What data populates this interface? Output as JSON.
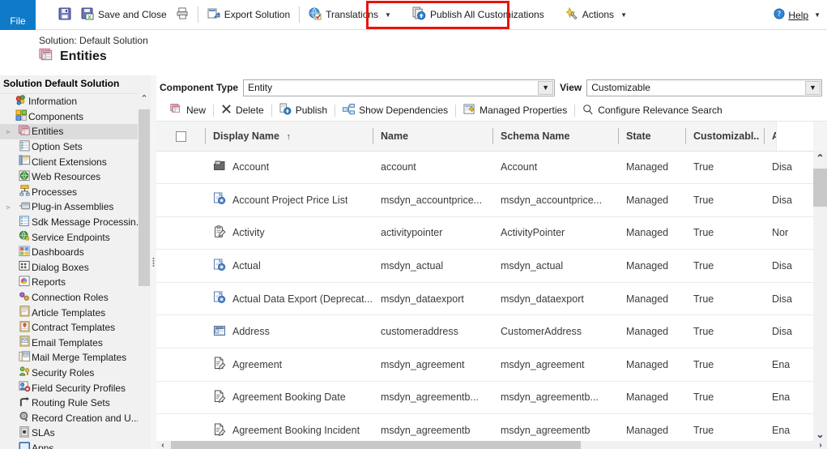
{
  "ribbon": {
    "file_label": "File",
    "buttons": [
      {
        "label": "",
        "icon": "save-icon",
        "name": "save-button"
      },
      {
        "label": "Save and Close",
        "icon": "save-and-close-icon",
        "name": "save-and-close-button"
      },
      {
        "label": "",
        "icon": "print-icon",
        "name": "print-button"
      },
      {
        "label": "Export Solution",
        "icon": "export-solution-icon",
        "name": "export-solution-button"
      },
      {
        "label": "Translations",
        "icon": "translations-icon",
        "name": "translations-button",
        "caret": true
      },
      {
        "label": "Publish All Customizations",
        "icon": "publish-all-icon",
        "name": "publish-all-customizations-button"
      },
      {
        "label": "Actions",
        "icon": "actions-icon",
        "name": "actions-button",
        "caret": true
      }
    ],
    "help_label": "Help",
    "highlight_color": "#e8140c"
  },
  "titlebar": {
    "solution_line": "Solution: Default Solution",
    "page_title": "Entities"
  },
  "sidebar": {
    "header": "Solution Default Solution",
    "items": [
      {
        "label": "Information",
        "icon": "information-icon",
        "indent": 0,
        "expander": "",
        "selected": false
      },
      {
        "label": "Components",
        "icon": "components-icon",
        "indent": 0,
        "expander": "",
        "selected": false
      },
      {
        "label": "Entities",
        "icon": "entities-icon",
        "indent": 1,
        "expander": "▹",
        "selected": true
      },
      {
        "label": "Option Sets",
        "icon": "option-sets-icon",
        "indent": 1,
        "expander": "",
        "selected": false
      },
      {
        "label": "Client Extensions",
        "icon": "client-extensions-icon",
        "indent": 1,
        "expander": "",
        "selected": false
      },
      {
        "label": "Web Resources",
        "icon": "web-resources-icon",
        "indent": 1,
        "expander": "",
        "selected": false
      },
      {
        "label": "Processes",
        "icon": "processes-icon",
        "indent": 1,
        "expander": "",
        "selected": false
      },
      {
        "label": "Plug-in Assemblies",
        "icon": "plugin-assemblies-icon",
        "indent": 1,
        "expander": "▹",
        "selected": false
      },
      {
        "label": "Sdk Message Processin...",
        "icon": "sdk-message-icon",
        "indent": 1,
        "expander": "",
        "selected": false
      },
      {
        "label": "Service Endpoints",
        "icon": "service-endpoints-icon",
        "indent": 1,
        "expander": "",
        "selected": false
      },
      {
        "label": "Dashboards",
        "icon": "dashboards-icon",
        "indent": 1,
        "expander": "",
        "selected": false
      },
      {
        "label": "Dialog Boxes",
        "icon": "dialog-boxes-icon",
        "indent": 1,
        "expander": "",
        "selected": false
      },
      {
        "label": "Reports",
        "icon": "reports-icon",
        "indent": 1,
        "expander": "",
        "selected": false
      },
      {
        "label": "Connection Roles",
        "icon": "connection-roles-icon",
        "indent": 1,
        "expander": "",
        "selected": false
      },
      {
        "label": "Article Templates",
        "icon": "article-templates-icon",
        "indent": 1,
        "expander": "",
        "selected": false
      },
      {
        "label": "Contract Templates",
        "icon": "contract-templates-icon",
        "indent": 1,
        "expander": "",
        "selected": false
      },
      {
        "label": "Email Templates",
        "icon": "email-templates-icon",
        "indent": 1,
        "expander": "",
        "selected": false
      },
      {
        "label": "Mail Merge Templates",
        "icon": "mail-merge-templates-icon",
        "indent": 1,
        "expander": "",
        "selected": false
      },
      {
        "label": "Security Roles",
        "icon": "security-roles-icon",
        "indent": 1,
        "expander": "",
        "selected": false
      },
      {
        "label": "Field Security Profiles",
        "icon": "field-security-profiles-icon",
        "indent": 1,
        "expander": "",
        "selected": false
      },
      {
        "label": "Routing Rule Sets",
        "icon": "routing-rule-sets-icon",
        "indent": 1,
        "expander": "",
        "selected": false
      },
      {
        "label": "Record Creation and U...",
        "icon": "record-creation-icon",
        "indent": 1,
        "expander": "",
        "selected": false
      },
      {
        "label": "SLAs",
        "icon": "slas-icon",
        "indent": 1,
        "expander": "",
        "selected": false
      },
      {
        "label": "Apps",
        "icon": "apps-icon",
        "indent": 1,
        "expander": "",
        "selected": false
      }
    ]
  },
  "filters": {
    "component_type_label": "Component Type",
    "component_type_value": "Entity",
    "view_label": "View",
    "view_value": "Customizable"
  },
  "actionbar": {
    "buttons": [
      {
        "label": "New",
        "icon": "new-icon",
        "name": "new-button"
      },
      {
        "label": "Delete",
        "icon": "delete-icon",
        "name": "delete-button"
      },
      {
        "label": "Publish",
        "icon": "publish-icon",
        "name": "publish-button"
      },
      {
        "label": "Show Dependencies",
        "icon": "show-dependencies-icon",
        "name": "show-dependencies-button"
      },
      {
        "label": "Managed Properties",
        "icon": "managed-properties-icon",
        "name": "managed-properties-button"
      },
      {
        "label": "Configure Relevance Search",
        "icon": "search-icon",
        "name": "configure-relevance-search-button"
      }
    ]
  },
  "grid": {
    "columns": [
      {
        "label": "Display Name",
        "sort": "↑"
      },
      {
        "label": "Name",
        "sort": ""
      },
      {
        "label": "Schema Name",
        "sort": ""
      },
      {
        "label": "State",
        "sort": ""
      },
      {
        "label": "Customizabl..",
        "sort": ""
      },
      {
        "label": "A",
        "sort": ""
      }
    ],
    "rows": [
      {
        "icon": "account-entity-icon",
        "display_name": "Account",
        "name": "account",
        "schema_name": "Account",
        "state": "Managed",
        "customizable": "True",
        "audit": "Disa"
      },
      {
        "icon": "custom-entity-icon",
        "display_name": "Account Project Price List",
        "name": "msdyn_accountprice...",
        "schema_name": "msdyn_accountprice...",
        "state": "Managed",
        "customizable": "True",
        "audit": "Disa"
      },
      {
        "icon": "activity-entity-icon",
        "display_name": "Activity",
        "name": "activitypointer",
        "schema_name": "ActivityPointer",
        "state": "Managed",
        "customizable": "True",
        "audit": "Nor"
      },
      {
        "icon": "custom-entity-icon",
        "display_name": "Actual",
        "name": "msdyn_actual",
        "schema_name": "msdyn_actual",
        "state": "Managed",
        "customizable": "True",
        "audit": "Disa"
      },
      {
        "icon": "custom-entity-icon",
        "display_name": "Actual Data Export (Deprecat...",
        "name": "msdyn_dataexport",
        "schema_name": "msdyn_dataexport",
        "state": "Managed",
        "customizable": "True",
        "audit": "Disa"
      },
      {
        "icon": "address-entity-icon",
        "display_name": "Address",
        "name": "customeraddress",
        "schema_name": "CustomerAddress",
        "state": "Managed",
        "customizable": "True",
        "audit": "Disa"
      },
      {
        "icon": "agreement-entity-icon",
        "display_name": "Agreement",
        "name": "msdyn_agreement",
        "schema_name": "msdyn_agreement",
        "state": "Managed",
        "customizable": "True",
        "audit": "Ena"
      },
      {
        "icon": "agreement-entity-icon",
        "display_name": "Agreement Booking Date",
        "name": "msdyn_agreementb...",
        "schema_name": "msdyn_agreementb...",
        "state": "Managed",
        "customizable": "True",
        "audit": "Ena"
      },
      {
        "icon": "agreement-entity-icon",
        "display_name": "Agreement Booking Incident",
        "name": "msdyn_agreementb",
        "schema_name": "msdyn_agreementb",
        "state": "Managed",
        "customizable": "True",
        "audit": "Ena"
      }
    ]
  }
}
